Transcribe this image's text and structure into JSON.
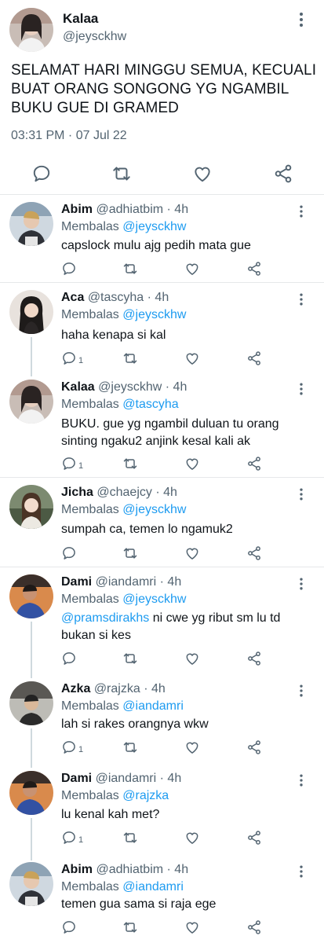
{
  "main_tweet": {
    "name": "Kalaa",
    "handle": "@jeysckhw",
    "text": "SELAMAT HARI MINGGU SEMUA, KECUALI BUAT ORANG SONGONG YG NGAMBIL BUKU GUE DI GRAMED",
    "timestamp": "03:31 PM · 07 Jul 22",
    "avatar_color": "#b8a39a"
  },
  "replies": [
    {
      "name": "Abim",
      "handle": "@adhiatbim",
      "age": "· 4h",
      "replying_label": "Membalas",
      "replying_to": "@jeysckhw",
      "text": "capslock mulu ajg pedih mata gue",
      "reply_count": "",
      "avatar_color": "#9fb4c7"
    },
    {
      "name": "Aca",
      "handle": "@tascyha",
      "age": "· 4h",
      "replying_label": "Membalas",
      "replying_to": "@jeysckhw",
      "text": "haha kenapa si kal",
      "reply_count": "1",
      "avatar_color": "#3a3432"
    },
    {
      "name": "Kalaa",
      "handle": "@jeysckhw",
      "age": "· 4h",
      "replying_label": "Membalas",
      "replying_to": "@tascyha",
      "text": "BUKU. gue yg ngambil duluan tu orang sinting ngaku2 anjink kesal kali ak",
      "reply_count": "1",
      "avatar_color": "#b8a39a"
    },
    {
      "name": "Jicha",
      "handle": "@chaejcy",
      "age": "· 4h",
      "replying_label": "Membalas",
      "replying_to": "@jeysckhw",
      "text": "sumpah ca, temen lo ngamuk2",
      "reply_count": "",
      "avatar_color": "#6b7a62"
    },
    {
      "name": "Dami",
      "handle": "@iandamri",
      "age": "· 4h",
      "replying_label": "Membalas",
      "replying_to": "@jeysckhw",
      "text_mention": "@pramsdirakhs",
      "text": " ni cwe yg ribut sm lu td bukan si kes",
      "reply_count": "",
      "avatar_color": "#c0663a"
    },
    {
      "name": "Azka",
      "handle": "@rajzka",
      "age": "· 4h",
      "replying_label": "Membalas",
      "replying_to": "@iandamri",
      "text": "lah si rakes orangnya wkw",
      "reply_count": "1",
      "avatar_color": "#8a8a86"
    },
    {
      "name": "Dami",
      "handle": "@iandamri",
      "age": "· 4h",
      "replying_label": "Membalas",
      "replying_to": "@rajzka",
      "text": "lu kenal kah met?",
      "reply_count": "1",
      "avatar_color": "#c0663a"
    },
    {
      "name": "Abim",
      "handle": "@adhiatbim",
      "age": "· 4h",
      "replying_label": "Membalas",
      "replying_to": "@iandamri",
      "text": "temen gua sama si raja ege",
      "reply_count": "",
      "avatar_color": "#9fb4c7"
    }
  ],
  "icons": {
    "reply": "reply-icon",
    "retweet": "retweet-icon",
    "like": "like-icon",
    "share": "share-icon",
    "more": "more-icon"
  },
  "colors": {
    "text": "#0f1419",
    "secondary": "#536471",
    "mention": "#1d9bf0",
    "divider": "#e6e8ea",
    "thread_line": "#cfd9de"
  }
}
